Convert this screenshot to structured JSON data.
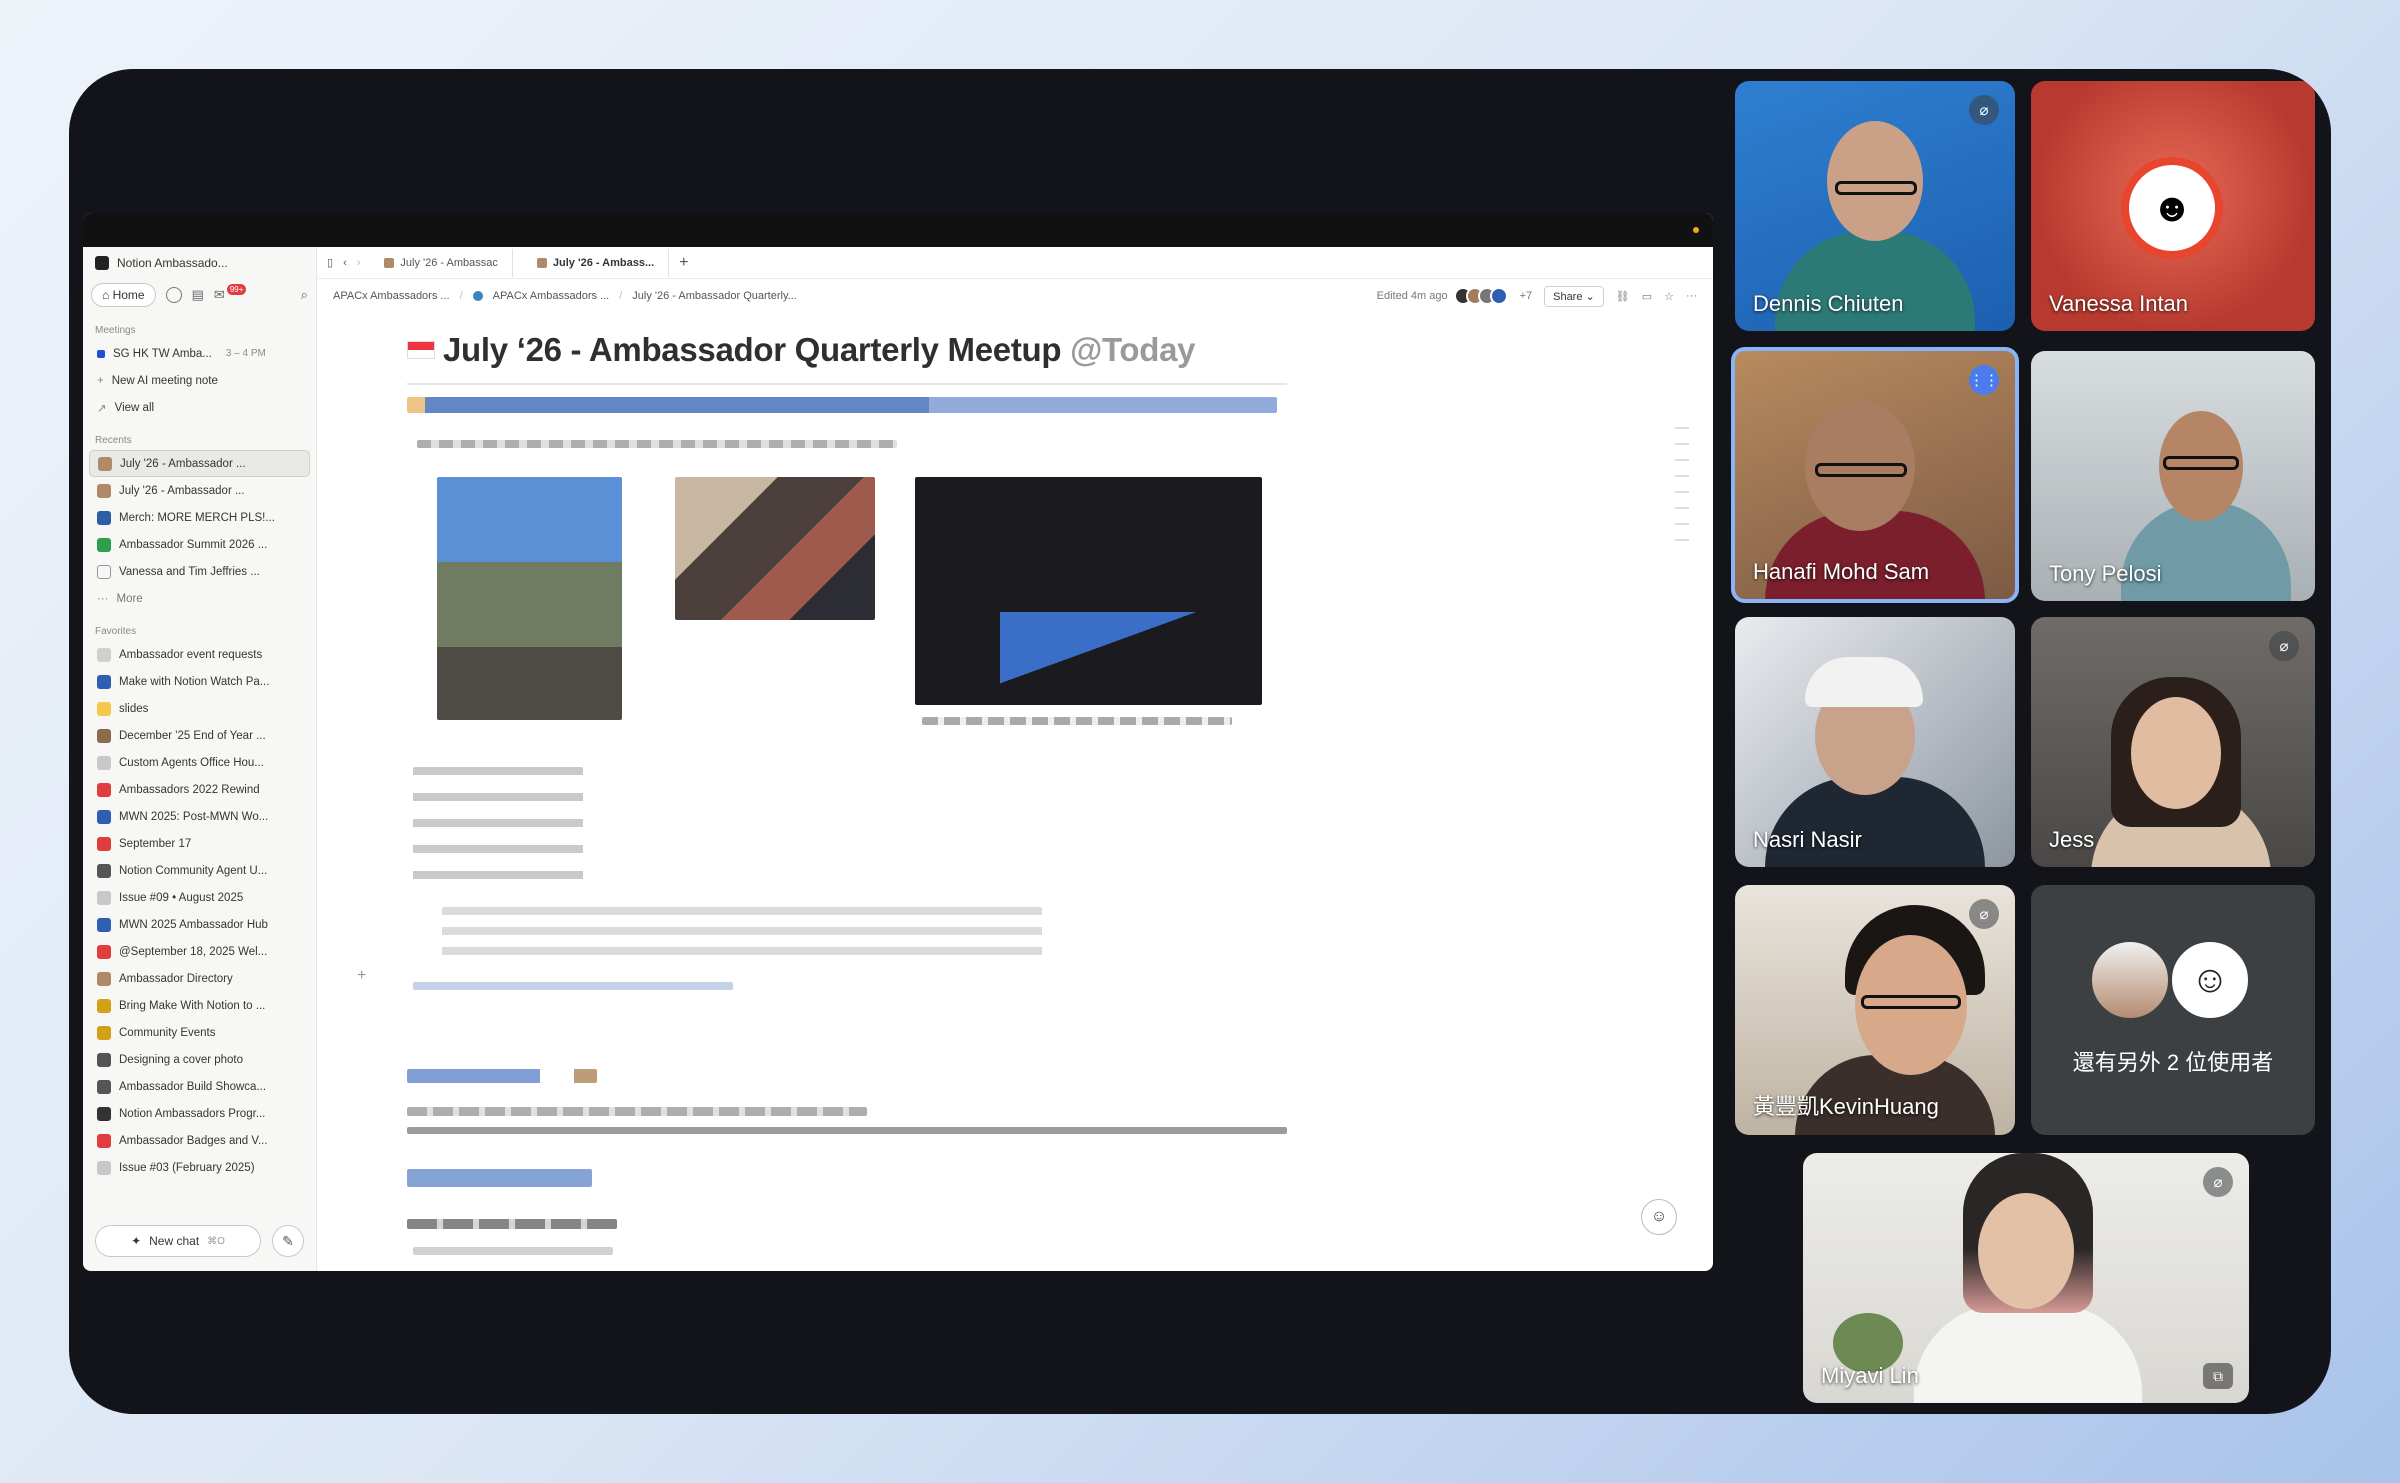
{
  "sidebar": {
    "workspace": "Notion Ambassado...",
    "home_label": "Home",
    "inbox_badge": "99+",
    "meetings_title": "Meetings",
    "meetings": [
      {
        "label": "SG HK TW Amba...",
        "time": "3 – 4 PM"
      },
      {
        "label": "New AI meeting note",
        "time": ""
      },
      {
        "label": "View all",
        "time": ""
      }
    ],
    "recents_title": "Recents",
    "recents": [
      "July '26 - Ambassador ...",
      "July '26 - Ambassador ...",
      "Merch: MORE MERCH PLS!...",
      "Ambassador Summit 2026 ...",
      "Vanessa and Tim Jeffries ...",
      "More"
    ],
    "favorites_title": "Favorites",
    "favorites": [
      "Ambassador event requests",
      "Make with Notion Watch Pa...",
      "slides",
      "December '25 End of Year ...",
      "Custom Agents Office Hou...",
      "Ambassadors 2022 Rewind",
      "MWN 2025: Post-MWN Wo...",
      "September 17",
      "Notion Community Agent U...",
      "Issue #09 • August 2025",
      "MWN 2025 Ambassador Hub",
      "@September 18, 2025 Wel...",
      "Ambassador Directory",
      "Bring Make With Notion to ...",
      "Community Events",
      "Designing a cover photo",
      "Ambassador Build Showca...",
      "Notion Ambassadors Progr...",
      "Ambassador Badges and V...",
      "Issue #03 (February 2025)"
    ],
    "new_chat": "New chat",
    "new_chat_shortcut": "⌘O"
  },
  "tabs": [
    {
      "label": "July '26 - Ambassac"
    },
    {
      "label": "July '26 - Ambass..."
    }
  ],
  "breadcrumbs": [
    "APACx Ambassadors ...",
    "APACx Ambassadors ...",
    "July '26 - Ambassador Quarterly..."
  ],
  "toolbar": {
    "edited": "Edited 4m ago",
    "extra_count": "+7",
    "share": "Share"
  },
  "doc": {
    "title": "July ‘26 - Ambassador Quarterly Meetup",
    "mention": "@Today"
  },
  "participants": [
    {
      "name": "Dennis Chiuten",
      "muted": true
    },
    {
      "name": "Vanessa Intan",
      "muted": false
    },
    {
      "name": "Hanafi Mohd Sam",
      "muted": false,
      "speaking": true
    },
    {
      "name": "Tony Pelosi",
      "muted": false
    },
    {
      "name": "Nasri Nasir",
      "muted": false
    },
    {
      "name": "Jess",
      "muted": true
    },
    {
      "name": "黃豐凱KevinHuang",
      "muted": true
    },
    {
      "name": "Miyavi Lin",
      "muted": true
    }
  ],
  "others_label": "還有另外 2 位使用者",
  "colors": {
    "frame": "#13141a",
    "tile_more": "#3c4043",
    "speaking": "#4b7bec",
    "vanessa_tile": "#c0392b"
  }
}
